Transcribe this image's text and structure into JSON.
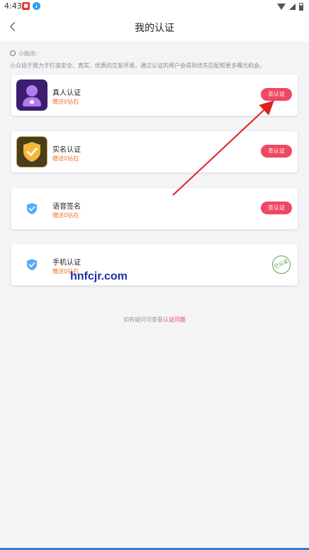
{
  "status": {
    "time": "4:43"
  },
  "header": {
    "title": "我的认证"
  },
  "tips": {
    "label": "小贴示:",
    "text": "小众括于致力于打造安全、真实、优质的交友环境，通过认证的用户会得到优先匹配和更多曝光机会。"
  },
  "cards": [
    {
      "title": "真人认证",
      "reward": "赠送0钻石",
      "action": "去认证",
      "verified": false
    },
    {
      "title": "实名认证",
      "reward": "赠送0钻石",
      "action": "去认证",
      "verified": false
    },
    {
      "title": "语音签名",
      "reward": "赠送0钻石",
      "action": "去认证",
      "verified": false
    },
    {
      "title": "手机认证",
      "reward": "赠送0钻石",
      "action": "已认证",
      "verified": true
    }
  ],
  "watermark": "hnfcjr.com",
  "footer": {
    "prefix": "如有疑问可查看",
    "link": "认证问题"
  },
  "colors": {
    "accent": "#ef4863",
    "reward": "#f07324",
    "verified": "#4c9a3e"
  }
}
